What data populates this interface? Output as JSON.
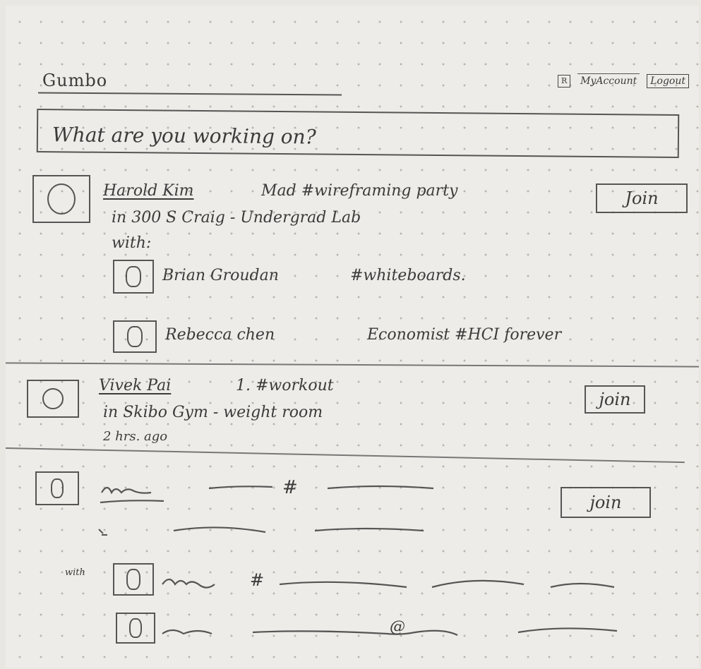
{
  "header": {
    "brand": "Gumbo",
    "account_icon_glyph": "R",
    "my_account": "MyAccount",
    "logout": "Logout"
  },
  "status_input": {
    "placeholder": "What are you working on?"
  },
  "posts": [
    {
      "name": "Harold Kim",
      "activity": "Mad #wireframing party",
      "location": "in 300 S Craig - Undergrad Lab",
      "with_label": "with:",
      "join_label": "Join",
      "companions": [
        {
          "name": "Brian Groudan",
          "note": "#whiteboards."
        },
        {
          "name": "Rebecca chen",
          "note": "Economist #HCI forever"
        }
      ]
    },
    {
      "name": "Vivek Pai",
      "activity": "1. #workout",
      "location": "in Skibo Gym - weight room",
      "time": "2 hrs. ago",
      "join_label": "join"
    },
    {
      "placeholder_mark": "#",
      "placeholder_at": "@",
      "with_label": "with",
      "join_label": "join"
    }
  ],
  "avatar_glyph": "O",
  "icons": [
    "user-avatar-icon",
    "account-icon"
  ]
}
